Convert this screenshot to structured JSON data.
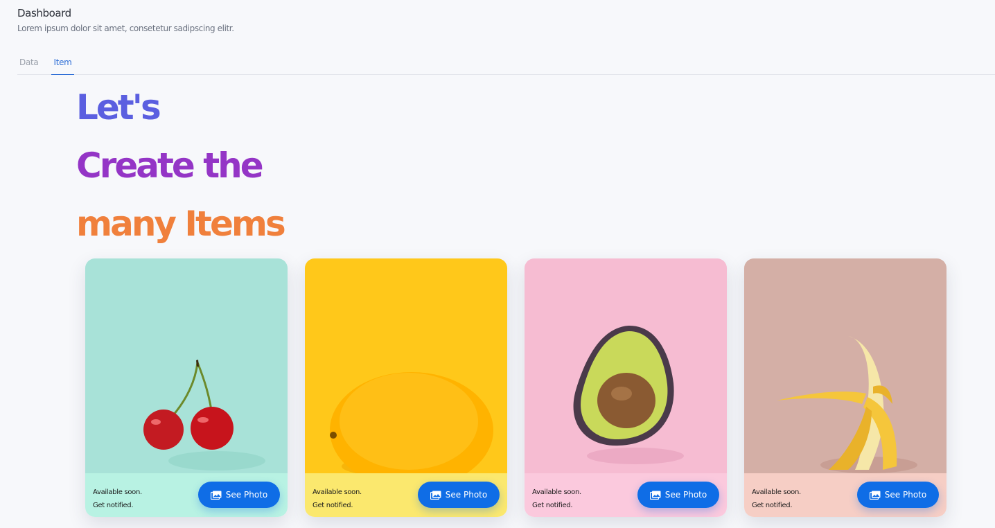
{
  "header": {
    "title": "Dashboard",
    "subtitle": "Lorem ipsum dolor sit amet, consetetur sadipscing elitr."
  },
  "tabs": [
    {
      "label": "Data",
      "active": false
    },
    {
      "label": "Item",
      "active": true
    }
  ],
  "headline": {
    "line1": "Let's",
    "line2": "Create the",
    "line3": "many Items",
    "colors": [
      "#5b5fe0",
      "#9435c6",
      "#f0803c"
    ]
  },
  "cards": [
    {
      "fruit": "cherries",
      "photo_bg": "#a8e2d8",
      "footer_bg": "#b8f2e3",
      "avail_line1": "Available soon.",
      "avail_line2": "Get notified.",
      "button_label": "See Photo",
      "button_icon": "photo-gallery-icon"
    },
    {
      "fruit": "lemon",
      "photo_bg": "#ffc81a",
      "footer_bg": "#fbe86e",
      "avail_line1": "Available soon.",
      "avail_line2": "Get notified.",
      "button_label": "See Photo",
      "button_icon": "photo-gallery-icon"
    },
    {
      "fruit": "avocado",
      "photo_bg": "#f6bcd2",
      "footer_bg": "#fbc9dd",
      "avail_line1": "Available soon.",
      "avail_line2": "Get notified.",
      "button_label": "See Photo",
      "button_icon": "photo-gallery-icon"
    },
    {
      "fruit": "banana",
      "photo_bg": "#d4afa6",
      "footer_bg": "#f6cec5",
      "avail_line1": "Available soon.",
      "avail_line2": "Get notified.",
      "button_label": "See Photo",
      "button_icon": "photo-gallery-icon"
    }
  ],
  "colors": {
    "accent": "#0f6de6",
    "tab_active": "#2f6fd6"
  }
}
